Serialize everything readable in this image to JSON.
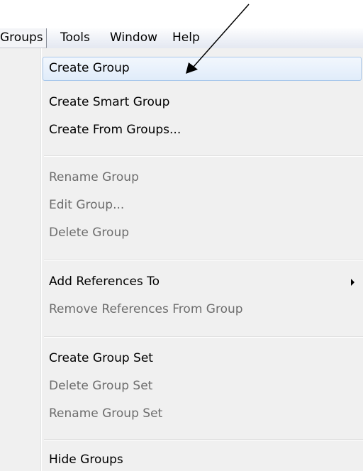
{
  "menubar": {
    "items": [
      "Groups",
      "Tools",
      "Window",
      "Help"
    ]
  },
  "menu": {
    "items": [
      {
        "label": "Create Group",
        "enabled": true,
        "highlighted": true
      },
      {
        "label": "Create Smart Group",
        "enabled": true
      },
      {
        "label": "Create From Groups...",
        "enabled": true
      },
      {
        "label": "Rename Group",
        "enabled": false
      },
      {
        "label": "Edit Group...",
        "enabled": false
      },
      {
        "label": "Delete Group",
        "enabled": false
      },
      {
        "label": "Add References To",
        "enabled": true,
        "submenu": true
      },
      {
        "label": "Remove References From Group",
        "enabled": false
      },
      {
        "label": "Create Group Set",
        "enabled": true
      },
      {
        "label": "Delete Group Set",
        "enabled": false
      },
      {
        "label": "Rename Group Set",
        "enabled": false
      },
      {
        "label": "Hide Groups",
        "enabled": true
      }
    ]
  },
  "colors": {
    "highlight_border": "#a8c8eb",
    "disabled_text": "#6d6d6d",
    "menu_background": "#f0f0f0"
  }
}
